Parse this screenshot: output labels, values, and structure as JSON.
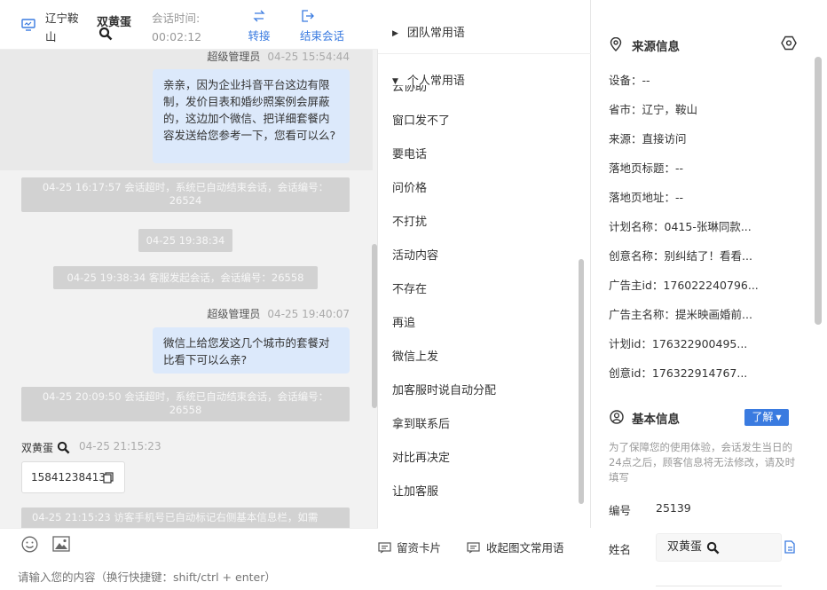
{
  "header": {
    "location_line1": "辽宁鞍",
    "location_line2": "山",
    "visitor_name": "双黄蛋",
    "session_time_label": "会话时间:",
    "session_time_value": "00:02:12",
    "transfer_label": "转接",
    "end_session_label": "结束会话",
    "accent": "#3a7be0"
  },
  "chat": {
    "msg1": {
      "sender": "超级管理员",
      "time": "04-25 15:54:44",
      "text": "亲亲，因为企业抖音平台这边有限制，发价目表和婚纱照案例会屏蔽的，这边加个微信、把详细套餐内容发送给您参考一下，您看可以么?"
    },
    "sys1": "04-25 16:17:57 会话超时，系统已自动结束会话，会话编号：26524",
    "sys2": "04-25 19:38:34",
    "sys3": "04-25 19:38:34 客服发起会话，会话编号：26558",
    "msg2": {
      "sender": "超级管理员",
      "time": "04-25 19:40:07",
      "text": "微信上给您发这几个城市的套餐对比看下可以么亲?"
    },
    "sys4": "04-25 20:09:50 会话超时，系统已自动结束会话，会话编号：26558",
    "msg3": {
      "sender": "双黄蛋",
      "time": "04-25 21:15:23",
      "phone": "15841238413"
    },
    "sys5": "04-25 21:15:23 访客手机号已自动标记右侧基本信息栏，如需"
  },
  "input": {
    "placeholder": "请输入您的内容（换行快捷键：shift/ctrl + enter）"
  },
  "phrases": {
    "team_group": "团队常用语",
    "personal_group": "个人常用语",
    "items": [
      "窗口发不了",
      "要电话",
      "问价格",
      "不打扰",
      "活动内容",
      "不存在",
      "再追",
      "微信上发",
      "加客服时说自动分配",
      "拿到联系后",
      "对比再决定",
      "让加客服"
    ],
    "leave_card": "留资卡片",
    "collapse_label": "收起图文常用语"
  },
  "source_info": {
    "title": "来源信息",
    "fields": [
      {
        "label": "设备：",
        "value": "--"
      },
      {
        "label": "省市：",
        "value": "辽宁，鞍山"
      },
      {
        "label": "来源：",
        "value": "直接访问"
      },
      {
        "label": "落地页标题：",
        "value": "--"
      },
      {
        "label": "落地页地址：",
        "value": "--"
      },
      {
        "label": "计划名称：",
        "value": "0415-张琳同款..."
      },
      {
        "label": "创意名称：",
        "value": "别纠结了！看看..."
      },
      {
        "label": "广告主id：",
        "value": "176022240796..."
      },
      {
        "label": "广告主名称：",
        "value": "提米映画婚前..."
      },
      {
        "label": "计划id：",
        "value": "176322900495..."
      },
      {
        "label": "创意id：",
        "value": "176322914767..."
      }
    ]
  },
  "basic_info": {
    "title": "基本信息",
    "learn_more": "了解",
    "notice": "为了保障您的使用体验，会话发生当日的24点之后，顾客信息将无法修改，请及时填写",
    "id_label": "编号",
    "id_value": "25139",
    "name_label": "姓名",
    "name_value": "双黄蛋"
  }
}
